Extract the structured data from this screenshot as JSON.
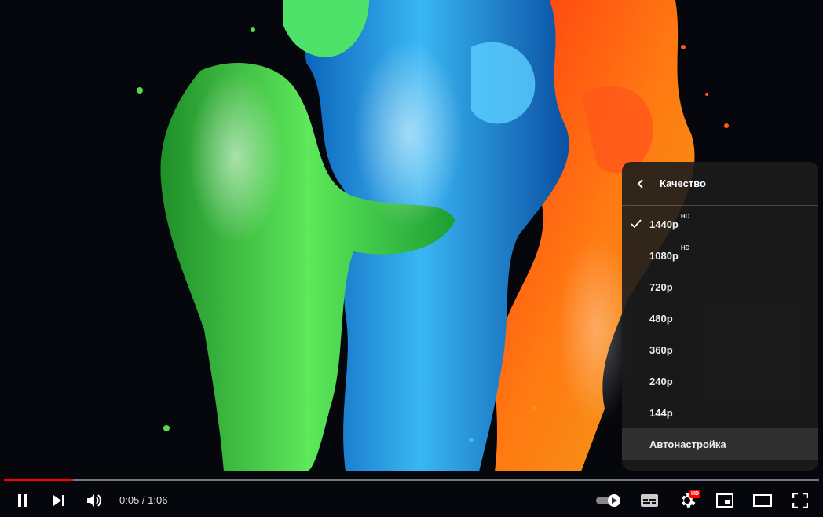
{
  "player": {
    "time_current": "0:05",
    "time_separator": " / ",
    "time_total": "1:06",
    "progress_fraction": 0.085
  },
  "quality_menu": {
    "title": "Качество",
    "items": [
      {
        "label": "1440p",
        "badge": "HD",
        "selected": true
      },
      {
        "label": "1080p",
        "badge": "HD",
        "selected": false
      },
      {
        "label": "720p",
        "badge": "",
        "selected": false
      },
      {
        "label": "480p",
        "badge": "",
        "selected": false
      },
      {
        "label": "360p",
        "badge": "",
        "selected": false
      },
      {
        "label": "240p",
        "badge": "",
        "selected": false
      },
      {
        "label": "144p",
        "badge": "",
        "selected": false
      },
      {
        "label": "Автонастройка",
        "badge": "",
        "selected": false,
        "hovered": true
      }
    ]
  },
  "settings_badge": "HD",
  "icons": {
    "pause": "pause-icon",
    "next": "next-icon",
    "volume": "volume-icon",
    "autoplay": "autoplay-toggle-icon",
    "subtitles": "subtitles-icon",
    "settings": "gear-icon",
    "miniplayer": "miniplayer-icon",
    "theater": "theater-mode-icon",
    "fullscreen": "fullscreen-icon"
  },
  "colors": {
    "progress": "#ff0000",
    "menu_bg": "#1c1c1c",
    "badge": "#ff0000"
  }
}
